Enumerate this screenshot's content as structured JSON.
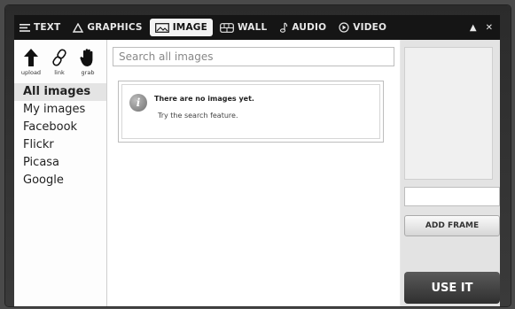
{
  "tabs": [
    {
      "label": "TEXT",
      "icon": "text-lines-icon"
    },
    {
      "label": "GRAPHICS",
      "icon": "triangle-icon"
    },
    {
      "label": "IMAGE",
      "icon": "image-icon",
      "active": true
    },
    {
      "label": "WALL",
      "icon": "wall-icon"
    },
    {
      "label": "AUDIO",
      "icon": "music-note-icon"
    },
    {
      "label": "VIDEO",
      "icon": "play-circle-icon"
    }
  ],
  "window_controls": {
    "collapse": "▲",
    "close": "✕"
  },
  "tools": [
    {
      "label": "upload",
      "icon": "upload-arrow-icon"
    },
    {
      "label": "link",
      "icon": "link-icon"
    },
    {
      "label": "grab",
      "icon": "hand-icon"
    }
  ],
  "sources": [
    {
      "label": "All images",
      "active": true
    },
    {
      "label": "My images"
    },
    {
      "label": "Facebook"
    },
    {
      "label": "Flickr"
    },
    {
      "label": "Picasa"
    },
    {
      "label": "Google"
    }
  ],
  "search": {
    "placeholder": "Search all images",
    "value": ""
  },
  "empty_state": {
    "title": "There are no images yet.",
    "subtitle": "Try the search feature."
  },
  "right_panel": {
    "add_frame_label": "ADD FRAME",
    "use_it_label": "USE IT"
  }
}
